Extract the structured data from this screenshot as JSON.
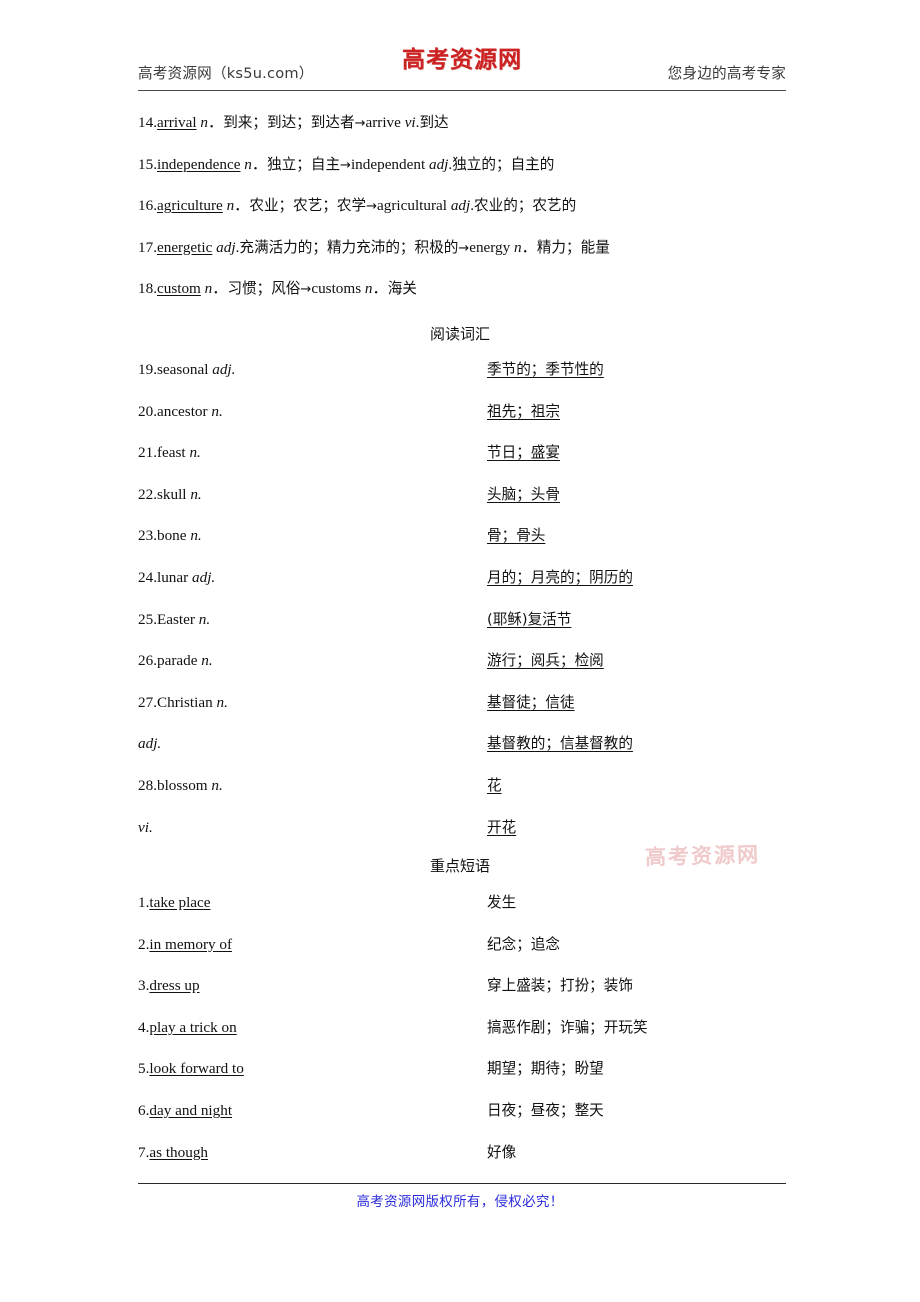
{
  "header": {
    "left_text": "高考资源网（ks5u.com）",
    "logo_text": "高考资源网",
    "right_text": "您身边的高考专家",
    "logo_color": "#cc2222"
  },
  "watermark": {
    "text": "高考资源网",
    "color": "#e29696"
  },
  "word_formation": {
    "items": [
      {
        "num": "14.",
        "headword": "arrival",
        "pos": "n",
        "sep": "．",
        "meaning": "到来；到达；到达者",
        "arrow": "→",
        "derived": "arrive",
        "derived_pos": "vi",
        "derived_dot": ".",
        "derived_meaning": "到达"
      },
      {
        "num": "15.",
        "headword": "independence",
        "pos": "n",
        "sep": "．",
        "meaning": "独立；自主",
        "arrow": "→",
        "derived": "independent",
        "derived_pos": "adj",
        "derived_dot": ".",
        "derived_meaning": "独立的；自主的"
      },
      {
        "num": "16.",
        "headword": "agriculture",
        "pos": "n",
        "sep": "．",
        "meaning": "农业；农艺；农学",
        "arrow": "→",
        "derived": "agricultural",
        "derived_pos": "adj",
        "derived_dot": ".",
        "derived_meaning": "农业的；农艺的"
      },
      {
        "num": "17.",
        "headword": "energetic",
        "pos": "adj",
        "sep": ".",
        "meaning": "充满活力的；精力充沛的；积极的",
        "arrow": "→",
        "derived": "energy",
        "derived_pos": "n",
        "derived_dot": "．",
        "derived_meaning": "精力；能量"
      },
      {
        "num": "18.",
        "headword": "custom",
        "pos": "n",
        "sep": "．",
        "meaning": "习惯；风俗",
        "arrow": "→",
        "derived": "customs",
        "derived_pos": "n",
        "derived_dot": "．",
        "derived_meaning": "海关"
      }
    ]
  },
  "reading_vocab": {
    "heading": "阅读词汇",
    "items": [
      {
        "num": "19.",
        "word": "seasonal",
        "pos": "adj.",
        "zh": "季节的；季节性的"
      },
      {
        "num": "20.",
        "word": "ancestor",
        "pos": "n.",
        "zh": "祖先；祖宗"
      },
      {
        "num": "21.",
        "word": "feast",
        "pos": "n.",
        "zh": "节日；盛宴"
      },
      {
        "num": "22.",
        "word": "skull",
        "pos": "n.",
        "zh": "头脑；头骨"
      },
      {
        "num": "23.",
        "word": "bone",
        "pos": "n.",
        "zh": "骨；骨头"
      },
      {
        "num": "24.",
        "word": "lunar",
        "pos": "adj.",
        "zh": "月的；月亮的；阴历的"
      },
      {
        "num": "25.",
        "word": "Easter",
        "pos": "n.",
        "zh": "(耶稣)复活节"
      },
      {
        "num": "26.",
        "word": "parade",
        "pos": "n.",
        "zh": "游行；阅兵；检阅"
      },
      {
        "num": "27.",
        "word": "Christian",
        "pos": "n.",
        "zh": "基督徒；信徒"
      },
      {
        "num": "",
        "word": "",
        "pos": "adj.",
        "zh": "基督教的；信基督教的"
      },
      {
        "num": "28.",
        "word": "blossom",
        "pos": "n.",
        "zh": "花"
      },
      {
        "num": "",
        "word": "",
        "pos": "vi.",
        "zh": "开花"
      }
    ]
  },
  "key_phrases": {
    "heading": "重点短语",
    "items": [
      {
        "num": "1.",
        "phrase": "take place",
        "zh": "发生"
      },
      {
        "num": "2.",
        "phrase": "in memory of",
        "zh": "纪念；追念"
      },
      {
        "num": "3.",
        "phrase": "dress up",
        "zh": "穿上盛装；打扮；装饰"
      },
      {
        "num": "4.",
        "phrase": "play a trick on",
        "zh": "搞恶作剧；诈骗；开玩笑"
      },
      {
        "num": "5.",
        "phrase": "look forward to",
        "zh": "期望；期待；盼望"
      },
      {
        "num": "6.",
        "phrase": "day and night",
        "zh": "日夜；昼夜；整天"
      },
      {
        "num": "7.",
        "phrase": "as though",
        "zh": "好像"
      }
    ]
  },
  "footer": {
    "text": "高考资源网版权所有，侵权必究！",
    "color": "#2b2bdd"
  }
}
